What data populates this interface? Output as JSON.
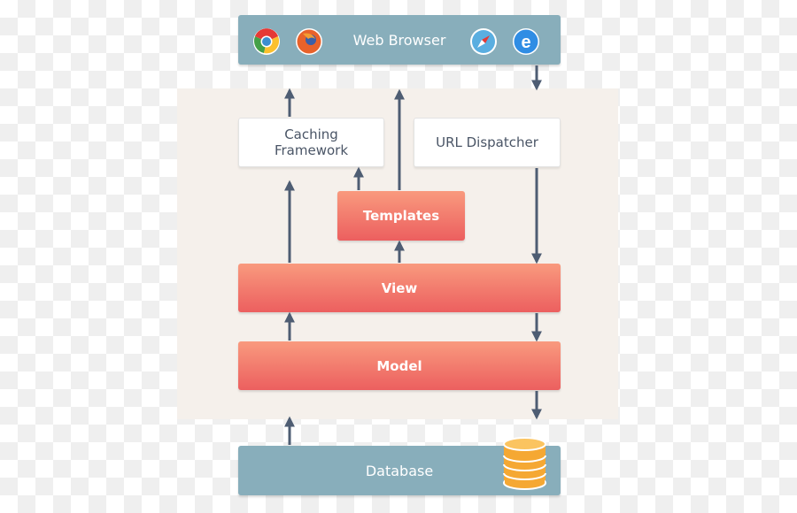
{
  "web_browser": {
    "label": "Web Browser",
    "icons": [
      "chrome-icon",
      "firefox-icon",
      "safari-icon",
      "internet-explorer-icon"
    ]
  },
  "caching": {
    "line1": "Caching",
    "line2": "Framework"
  },
  "url_dispatcher": {
    "label": "URL Dispatcher"
  },
  "templates": {
    "label": "Templates"
  },
  "view": {
    "label": "View"
  },
  "model": {
    "label": "Model"
  },
  "database": {
    "label": "Database",
    "icon": "database-icon"
  },
  "colors": {
    "teal": "#88aebb",
    "red_top": "#f99a7e",
    "red_bottom": "#ec5f5f",
    "arrow": "#4e5d73",
    "panel": "#f5f0eb",
    "db_gold": "#f5b042"
  }
}
